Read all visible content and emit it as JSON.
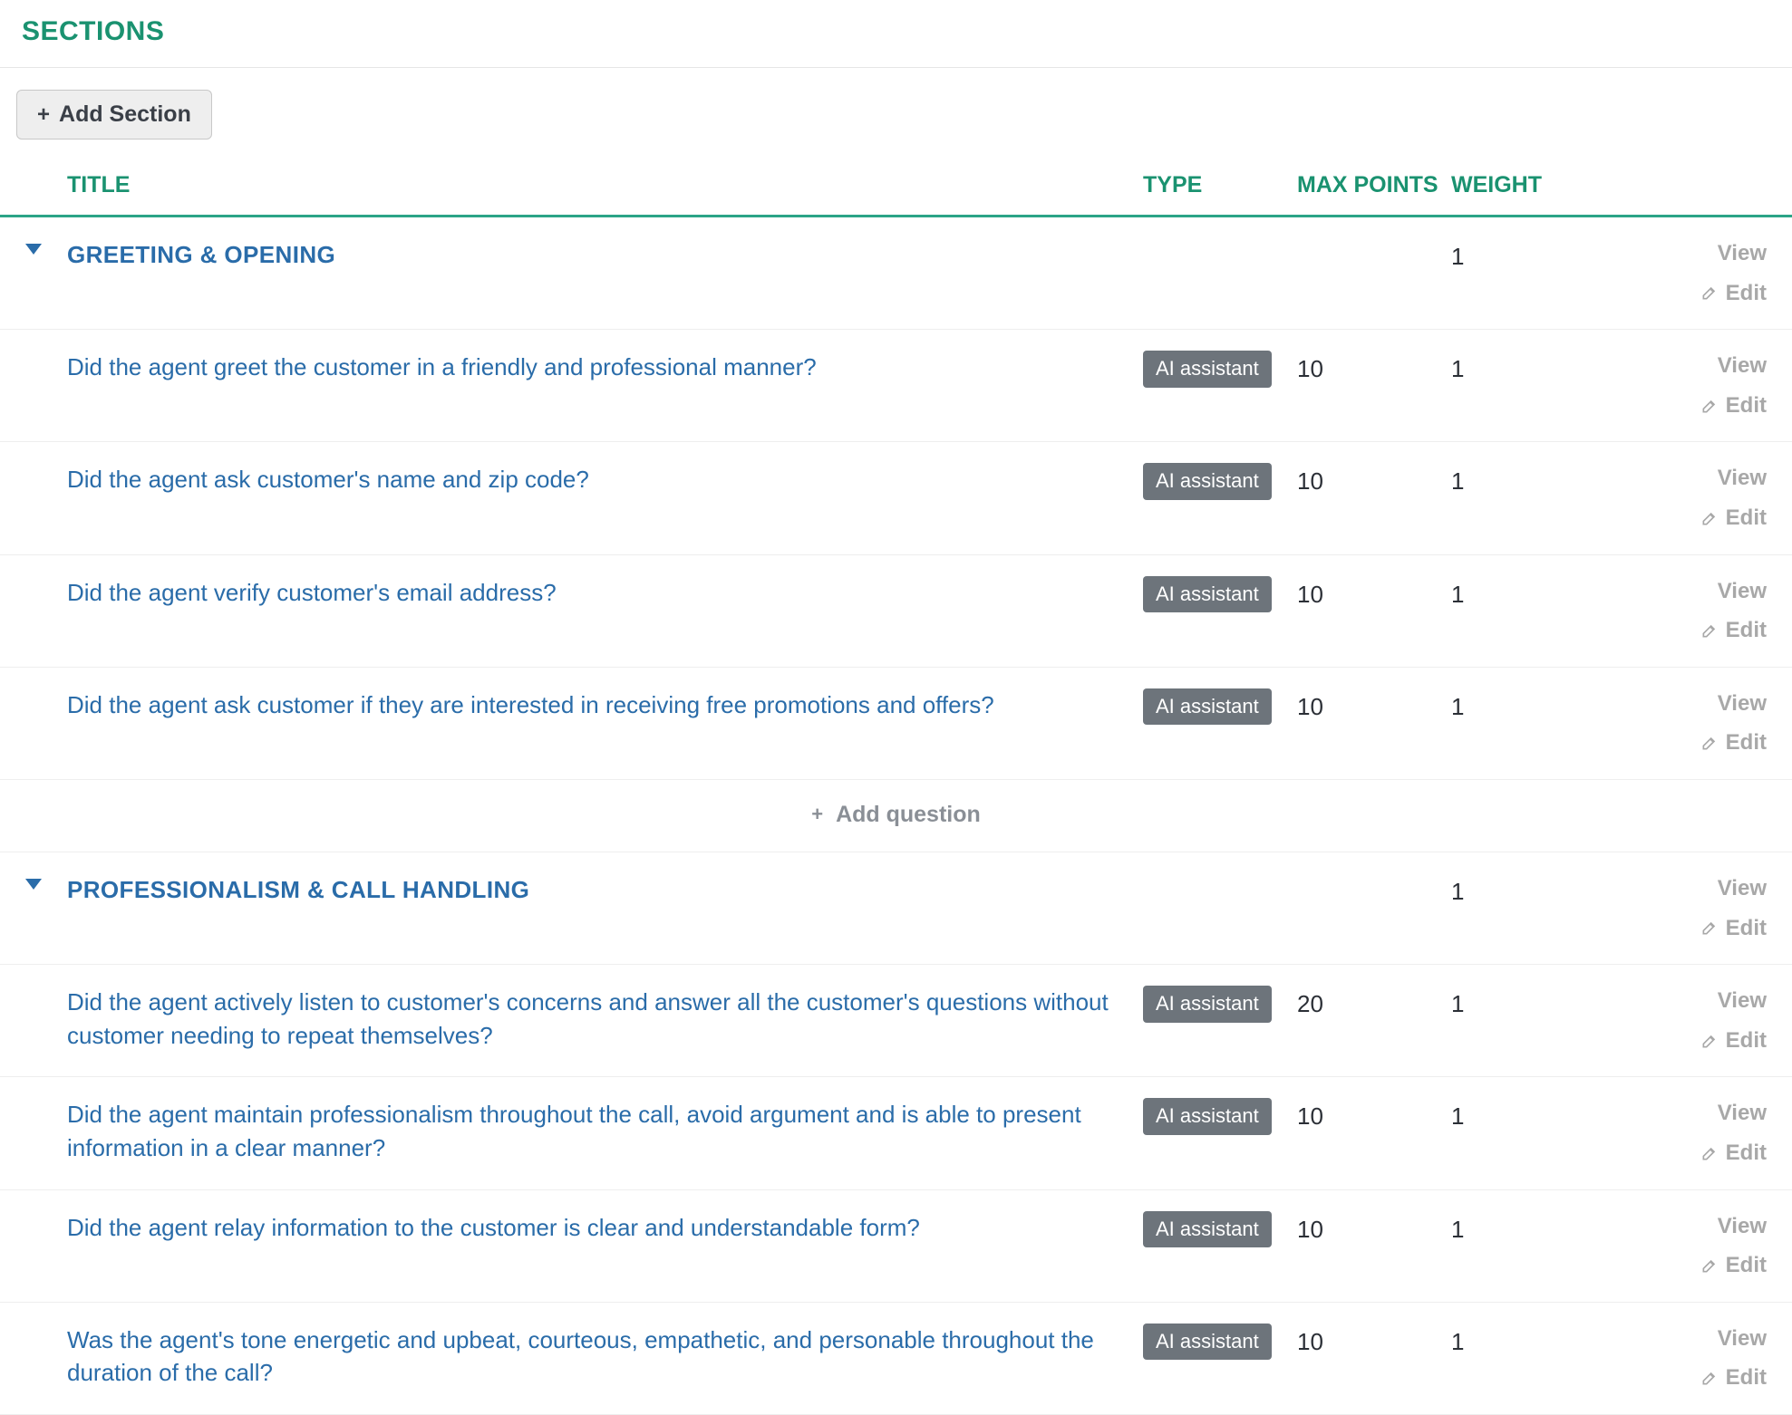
{
  "page_title": "SECTIONS",
  "toolbar": {
    "add_section_label": "Add Section"
  },
  "columns": {
    "title": "TITLE",
    "type": "TYPE",
    "max_points": "MAX POINTS",
    "weight": "WEIGHT"
  },
  "actions": {
    "view": "View",
    "edit": "Edit",
    "add_question": "Add question"
  },
  "ai_badge": "AI assistant",
  "sections": [
    {
      "name": "GREETING & OPENING",
      "weight": "1",
      "questions": [
        {
          "title": "Did the agent greet the customer in a friendly and professional manner?",
          "type_badge": "AI assistant",
          "max_points": "10",
          "weight": "1"
        },
        {
          "title": "Did the agent ask customer's name and zip code?",
          "type_badge": "AI assistant",
          "max_points": "10",
          "weight": "1"
        },
        {
          "title": "Did the agent verify customer's email address?",
          "type_badge": "AI assistant",
          "max_points": "10",
          "weight": "1"
        },
        {
          "title": "Did the agent ask customer if they are interested in receiving free promotions and offers?",
          "type_badge": "AI assistant",
          "max_points": "10",
          "weight": "1"
        }
      ]
    },
    {
      "name": "PROFESSIONALISM & CALL HANDLING",
      "weight": "1",
      "questions": [
        {
          "title": "Did the agent actively listen to customer's concerns and answer all the customer's questions without customer needing to repeat themselves?",
          "type_badge": "AI assistant",
          "max_points": "20",
          "weight": "1"
        },
        {
          "title": "Did the agent maintain professionalism throughout the call, avoid argument and is able to present information in a clear manner?",
          "type_badge": "AI assistant",
          "max_points": "10",
          "weight": "1"
        },
        {
          "title": "Did the agent relay information to the customer is clear and understandable form?",
          "type_badge": "AI assistant",
          "max_points": "10",
          "weight": "1"
        },
        {
          "title": "Was the agent's tone energetic and upbeat, courteous, empathetic, and personable throughout the duration of the call?",
          "type_badge": "AI assistant",
          "max_points": "10",
          "weight": "1"
        }
      ]
    }
  ]
}
